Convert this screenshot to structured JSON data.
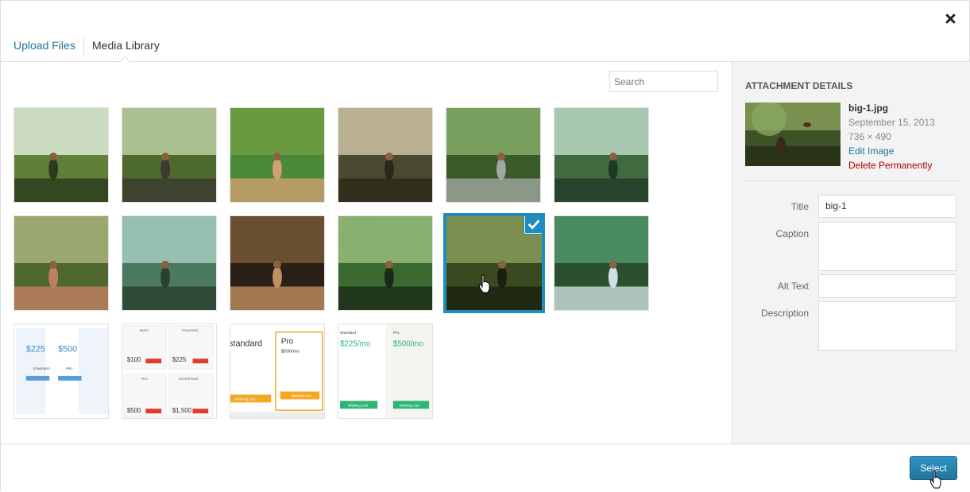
{
  "router": {
    "tabs": [
      {
        "label": "Upload Files",
        "active": false
      },
      {
        "label": "Media Library",
        "active": true
      }
    ]
  },
  "search": {
    "placeholder": "Search"
  },
  "grid": {
    "items": [
      {
        "kind": "photo",
        "palette": [
          "#ccdcc0",
          "#5f7f3a",
          "#2b3a1c"
        ]
      },
      {
        "kind": "photo",
        "palette": [
          "#aac090",
          "#4e6a2c",
          "#3a3a30"
        ]
      },
      {
        "kind": "photo",
        "palette": [
          "#6a9a40",
          "#4a8a3a",
          "#d0a070"
        ]
      },
      {
        "kind": "photo",
        "palette": [
          "#b8b090",
          "#4a4a30",
          "#2a2818"
        ]
      },
      {
        "kind": "photo",
        "palette": [
          "#7aa060",
          "#3a5a2a",
          "#a0a8a0"
        ]
      },
      {
        "kind": "photo",
        "palette": [
          "#a8c8b0",
          "#406a40",
          "#203828"
        ]
      },
      {
        "kind": "photo",
        "palette": [
          "#9aa870",
          "#506830",
          "#c08060"
        ]
      },
      {
        "kind": "photo",
        "palette": [
          "#98c0b0",
          "#4a7a60",
          "#2a4030"
        ]
      },
      {
        "kind": "photo",
        "palette": [
          "#6a5030",
          "#2a2018",
          "#c09060"
        ]
      },
      {
        "kind": "photo",
        "palette": [
          "#88b070",
          "#3a6a30",
          "#1a2a18"
        ]
      },
      {
        "kind": "photo",
        "palette": [
          "#7a9050",
          "#3a4a20",
          "#1a2010"
        ],
        "selected": true
      },
      {
        "kind": "photo",
        "palette": [
          "#4a8a60",
          "#2a5030",
          "#d0e0e0"
        ]
      },
      {
        "kind": "pricing",
        "texts": [
          "$225",
          "$500",
          "STANDARD",
          "PRO"
        ]
      },
      {
        "kind": "pricing",
        "texts": [
          "BASIC",
          "STANDARD",
          "PRO",
          "ENTERPRISE",
          "$100",
          "$225",
          "$500",
          "$1,500"
        ]
      },
      {
        "kind": "pricing",
        "texts": [
          "standard",
          "Pro",
          "$500/mo",
          "Waiting List",
          "Waiting List"
        ]
      },
      {
        "kind": "pricing",
        "texts": [
          "Standard",
          "$225/mo",
          "Pro",
          "$500/mo",
          "Waiting List",
          "Waiting List"
        ]
      }
    ]
  },
  "sidebar": {
    "heading": "ATTACHMENT DETAILS",
    "filename": "big-1.jpg",
    "date": "September 15, 2013",
    "dimensions": "736 × 490",
    "edit_label": "Edit Image",
    "delete_label": "Delete Permanently",
    "fields": {
      "title_label": "Title",
      "title_value": "big-1",
      "caption_label": "Caption",
      "alt_label": "Alt Text",
      "description_label": "Description"
    }
  },
  "toolbar": {
    "select_label": "Select"
  },
  "colors": {
    "accent": "#21759b",
    "selected_border": "#1e8cbe",
    "delete": "#aa0000"
  }
}
